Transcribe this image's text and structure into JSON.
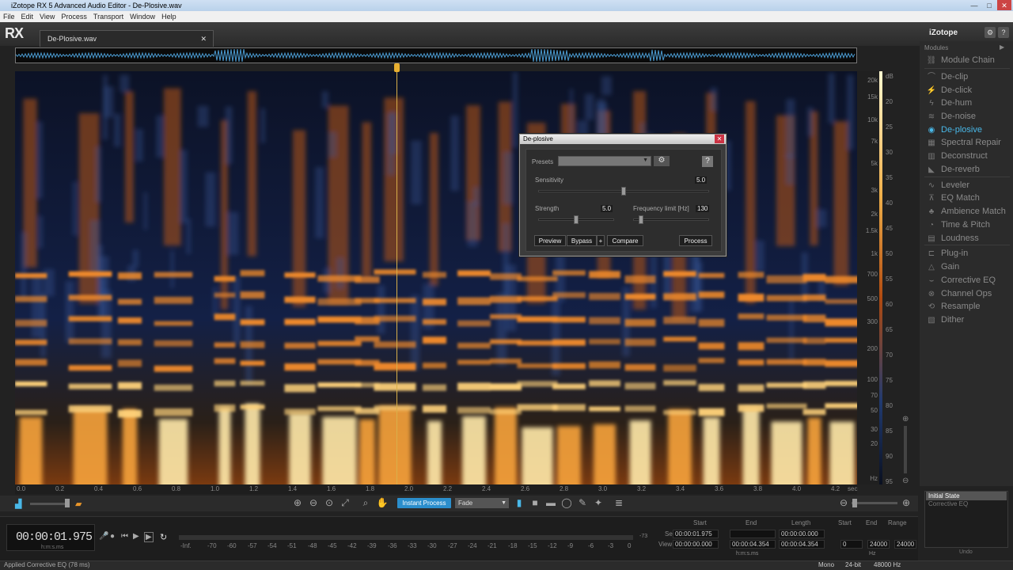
{
  "window": {
    "title": "iZotope RX 5 Advanced Audio Editor - De-Plosive.wav"
  },
  "menu": [
    "File",
    "Edit",
    "View",
    "Process",
    "Transport",
    "Window",
    "Help"
  ],
  "app": {
    "logo": "RX",
    "file_tab": "De-Plosive.wav",
    "brand": "iZotope"
  },
  "spectrogram": {
    "freq_ticks": [
      "20k",
      "15k",
      "10k",
      "7k",
      "5k",
      "3k",
      "2k",
      "1.5k",
      "1k",
      "700",
      "500",
      "300",
      "200",
      "100",
      "70",
      "50",
      "30",
      "20",
      "Hz"
    ],
    "db_ticks": [
      "dB",
      "20",
      "25",
      "30",
      "35",
      "40",
      "45",
      "50",
      "55",
      "60",
      "65",
      "70",
      "75",
      "80",
      "85",
      "90",
      "95"
    ],
    "time_ticks": [
      "0.0",
      "0.2",
      "0.4",
      "0.6",
      "0.8",
      "1.0",
      "1.2",
      "1.4",
      "1.6",
      "1.8",
      "2.0",
      "2.2",
      "2.4",
      "2.6",
      "2.8",
      "3.0",
      "3.2",
      "3.4",
      "3.6",
      "3.8",
      "4.0",
      "4.2",
      "sec"
    ]
  },
  "toolbar": {
    "instant_process": "Instant Process",
    "fade_mode": "Fade"
  },
  "transport": {
    "timecode": "00:00:01.975",
    "timecode_unit": "h:m:s.ms"
  },
  "meter": {
    "labels": [
      "-Inf.",
      "-70",
      "-60",
      "-57",
      "-54",
      "-51",
      "-48",
      "-45",
      "-42",
      "-39",
      "-36",
      "-33",
      "-30",
      "-27",
      "-24",
      "-21",
      "-18",
      "-15",
      "-12",
      "-9",
      "-6",
      "-3",
      "0"
    ],
    "peak": "-73"
  },
  "selection": {
    "headers": [
      "Start",
      "End",
      "Length",
      "Start",
      "End",
      "Range"
    ],
    "row_labels": [
      "Sel",
      "View"
    ],
    "sel": {
      "start": "00:00:01.975",
      "end": "",
      "length": "00:00:00.000"
    },
    "view": {
      "start": "00:00:00.000",
      "end": "00:00:04.354",
      "length": "00:00:04.354"
    },
    "freq": {
      "start": "0",
      "end": "24000",
      "range": "24000"
    },
    "time_unit": "h:m:s.ms",
    "freq_unit": "Hz"
  },
  "status": {
    "message": "Applied Corrective EQ (78 ms)",
    "channels": "Mono",
    "bit_depth": "24-bit",
    "sample_rate": "48000 Hz"
  },
  "modules": {
    "header": "Modules",
    "items": [
      {
        "label": "Module Chain",
        "icon": "chain-icon"
      },
      {
        "label": "De-clip",
        "icon": "declip-icon"
      },
      {
        "label": "De-click",
        "icon": "declick-icon"
      },
      {
        "label": "De-hum",
        "icon": "dehum-icon"
      },
      {
        "label": "De-noise",
        "icon": "denoise-icon"
      },
      {
        "label": "De-plosive",
        "icon": "deplosive-icon",
        "active": true
      },
      {
        "label": "Spectral Repair",
        "icon": "spectral-repair-icon"
      },
      {
        "label": "Deconstruct",
        "icon": "deconstruct-icon"
      },
      {
        "label": "De-reverb",
        "icon": "dereverb-icon"
      },
      {
        "label": "Leveler",
        "icon": "leveler-icon"
      },
      {
        "label": "EQ Match",
        "icon": "eq-match-icon"
      },
      {
        "label": "Ambience Match",
        "icon": "ambience-match-icon"
      },
      {
        "label": "Time & Pitch",
        "icon": "time-pitch-icon"
      },
      {
        "label": "Loudness",
        "icon": "loudness-icon"
      },
      {
        "label": "Plug-in",
        "icon": "plugin-icon"
      },
      {
        "label": "Gain",
        "icon": "gain-icon"
      },
      {
        "label": "Corrective EQ",
        "icon": "corrective-eq-icon"
      },
      {
        "label": "Channel Ops",
        "icon": "channel-ops-icon"
      },
      {
        "label": "Resample",
        "icon": "resample-icon"
      },
      {
        "label": "Dither",
        "icon": "dither-icon"
      }
    ]
  },
  "undo": {
    "items": [
      "Initial State",
      "Corrective EQ"
    ],
    "label": "Undo"
  },
  "dialog": {
    "title": "De-plosive",
    "presets_label": "Presets",
    "help": "?",
    "sensitivity_label": "Sensitivity",
    "sensitivity_value": "5.0",
    "sensitivity_level": 0.5,
    "strength_label": "Strength",
    "strength_value": "5.0",
    "strength_level": 0.5,
    "freq_limit_label": "Frequency limit [Hz]",
    "freq_limit_value": "130",
    "freq_limit_level": 0.1,
    "buttons": {
      "preview": "Preview",
      "bypass": "Bypass",
      "bypass_more": "+",
      "compare": "Compare",
      "process": "Process"
    }
  },
  "colors": {
    "accent": "#2b8ecc",
    "active_module": "#49b8e8",
    "playhead": "#e9b030"
  }
}
